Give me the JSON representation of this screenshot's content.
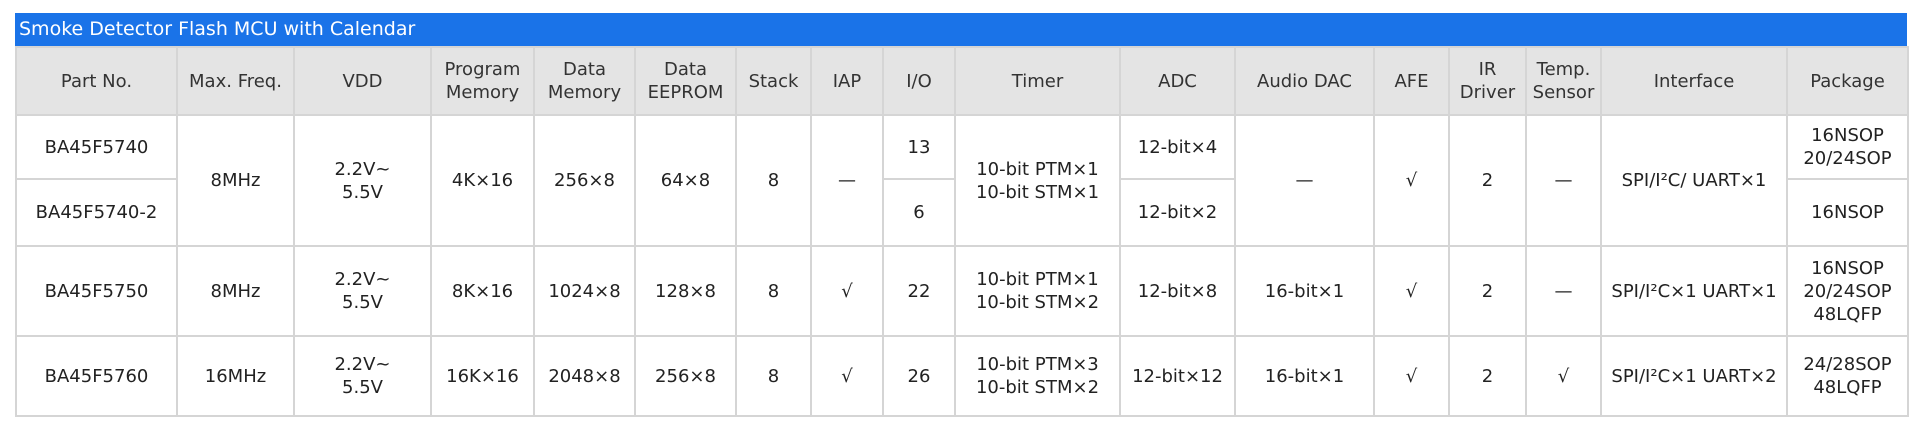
{
  "title": "Smoke Detector Flash MCU with Calendar",
  "headers": {
    "part_no": "Part No.",
    "max_freq": "Max. Freq.",
    "vdd": "VDD",
    "program_memory": "Program\nMemory",
    "data_memory": "Data\nMemory",
    "data_eeprom": "Data\nEEPROM",
    "stack": "Stack",
    "iap": "IAP",
    "io": "I/O",
    "timer": "Timer",
    "adc": "ADC",
    "audio_dac": "Audio DAC",
    "afe": "AFE",
    "ir_driver": "IR\nDriver",
    "temp_sensor": "Temp.\nSensor",
    "interface": "Interface",
    "package": "Package"
  },
  "g1": {
    "part_a": "BA45F5740",
    "part_b": "BA45F5740-2",
    "max_freq": "8MHz",
    "vdd": "2.2V~\n5.5V",
    "program_memory": "4K×16",
    "data_memory": "256×8",
    "data_eeprom": "64×8",
    "stack": "8",
    "iap": "—",
    "io_a": "13",
    "io_b": "6",
    "timer": "10-bit PTM×1\n10-bit STM×1",
    "adc_a": "12-bit×4",
    "adc_b": "12-bit×2",
    "audio_dac": "—",
    "afe": "√",
    "ir_driver": "2",
    "temp_sensor": "—",
    "interface": "SPI/I²C/ UART×1",
    "package_a": "16NSOP\n20/24SOP",
    "package_b": "16NSOP"
  },
  "r3": {
    "part": "BA45F5750",
    "max_freq": "8MHz",
    "vdd": "2.2V~\n5.5V",
    "program_memory": "8K×16",
    "data_memory": "1024×8",
    "data_eeprom": "128×8",
    "stack": "8",
    "iap": "√",
    "io": "22",
    "timer": "10-bit PTM×1\n10-bit STM×2",
    "adc": "12-bit×8",
    "audio_dac": "16-bit×1",
    "afe": "√",
    "ir_driver": "2",
    "temp_sensor": "—",
    "interface": "SPI/I²C×1 UART×1",
    "package": "16NSOP\n20/24SOP\n48LQFP"
  },
  "r4": {
    "part": "BA45F5760",
    "max_freq": "16MHz",
    "vdd": "2.2V~\n5.5V",
    "program_memory": "16K×16",
    "data_memory": "2048×8",
    "data_eeprom": "256×8",
    "stack": "8",
    "iap": "√",
    "io": "26",
    "timer": "10-bit PTM×3\n10-bit STM×2",
    "adc": "12-bit×12",
    "audio_dac": "16-bit×1",
    "afe": "√",
    "ir_driver": "2",
    "temp_sensor": "√",
    "interface": "SPI/I²C×1 UART×2",
    "package": "24/28SOP\n48LQFP"
  }
}
